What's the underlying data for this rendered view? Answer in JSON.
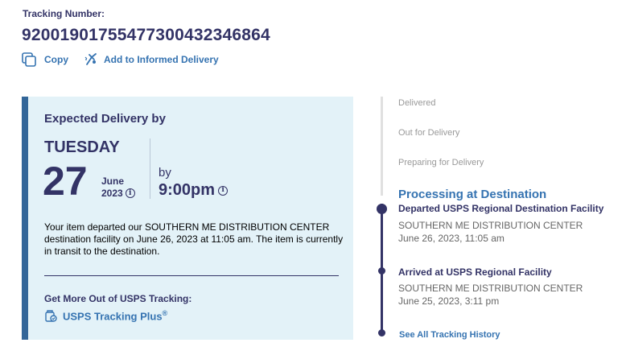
{
  "header": {
    "tracking_label": "Tracking Number:",
    "tracking_number": "9200190175547730043234686­4"
  },
  "actions": {
    "copy_label": "Copy",
    "informed_label": "Add to Informed Delivery"
  },
  "delivery": {
    "title": "Expected Delivery by",
    "day": "TUESDAY",
    "date": "27",
    "month": "June",
    "year": "2023",
    "by": "by",
    "time": "9:00pm",
    "description": "Your item departed our SOUTHERN ME DISTRIBUTION CENTER destination facility on June 26, 2023 at 11:05 am. The item is currently in transit to the destination.",
    "more_title": "Get More Out of USPS Tracking:",
    "plus_label": "USPS Tracking Plus",
    "plus_mark": "®"
  },
  "timeline": {
    "pending": [
      "Delivered",
      "Out for Delivery",
      "Preparing for Delivery"
    ],
    "current_status": "Processing at Destination",
    "events": [
      {
        "title": "Departed USPS Regional Destination Facility",
        "location": "SOUTHERN ME DISTRIBUTION CENTER",
        "date": "June 26, 2023, 11:05 am"
      },
      {
        "title": "Arrived at USPS Regional Facility",
        "location": "SOUTHERN ME DISTRIBUTION CENTER",
        "date": "June 25, 2023, 3:11 pm"
      }
    ],
    "history_link": "See All Tracking History"
  },
  "icons": {
    "copy": "copy-icon",
    "informed": "informed-delivery-icon",
    "plus": "tracking-plus-icon",
    "info": "info-icon"
  },
  "colors": {
    "navy": "#333366",
    "link_blue": "#3573b1",
    "card_bg": "#e3f2f8",
    "card_border": "#336699",
    "pending_grey": "#999999"
  }
}
